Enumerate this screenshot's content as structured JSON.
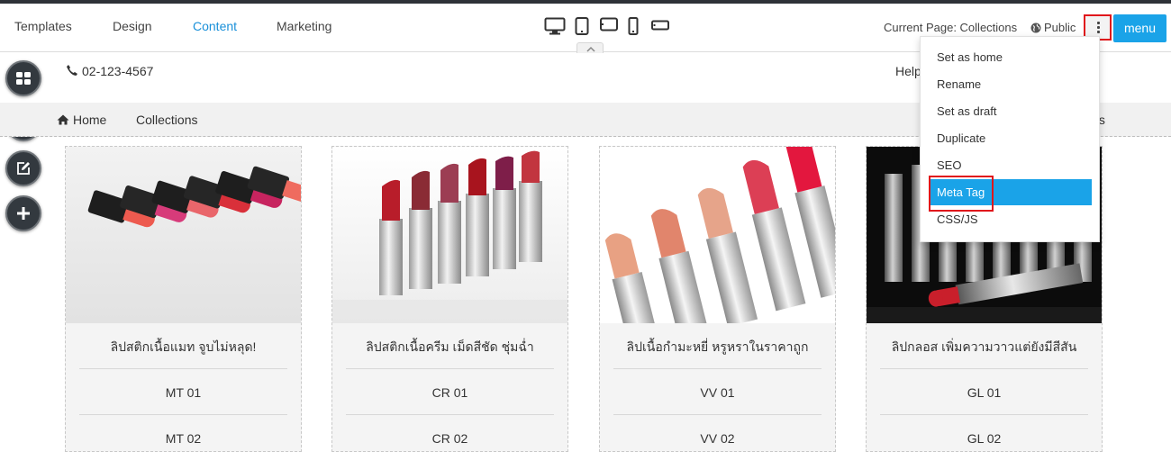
{
  "toolbar": {
    "tabs": [
      "Templates",
      "Design",
      "Content",
      "Marketing"
    ],
    "active_tab": "Content",
    "current_page": "Current Page: Collections",
    "visibility": "Public",
    "menu_label": "menu"
  },
  "devices": [
    "desktop-icon",
    "tablet-icon",
    "tablet-landscape-icon",
    "phone-icon",
    "phone-landscape-icon"
  ],
  "sidebar": [
    "blocks-icon",
    "stack-icon",
    "edit-icon",
    "add-icon"
  ],
  "header": {
    "phone": "02-123-4567",
    "help_partial": "Help"
  },
  "nav": {
    "home": "Home",
    "collections": "Collections",
    "tail_partial": "ts"
  },
  "dropdown": {
    "items": [
      "Set as home",
      "Rename",
      "Set as draft",
      "Duplicate",
      "SEO",
      "Meta Tag",
      "CSS/JS"
    ],
    "highlighted": "Meta Tag"
  },
  "products": [
    {
      "title": "ลิปสติกเนื้อแมท จูบไม่หลุด!",
      "codes": [
        "MT 01",
        "MT 02"
      ]
    },
    {
      "title": "ลิปสติกเนื้อครีม เม็ดสีชัด ชุ่มฉ่ำ",
      "codes": [
        "CR 01",
        "CR 02"
      ]
    },
    {
      "title": "ลิปเนื้อกำมะหยี่ หรูหราในราคาถูก",
      "codes": [
        "VV 01",
        "VV 02"
      ]
    },
    {
      "title": "ลิปกลอส เพิ่มความวาวแต่ยังมีสีสัน",
      "codes": [
        "GL 01",
        "GL 02"
      ]
    }
  ],
  "colors": {
    "accent": "#1aa3e8",
    "active_tab": "#1a90d9",
    "highlight_box": "#e0161b",
    "sidebar_button": "#33393f"
  }
}
